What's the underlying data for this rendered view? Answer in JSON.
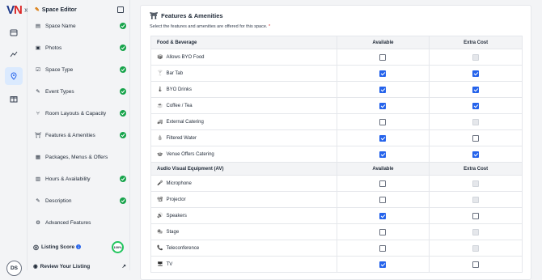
{
  "rail": {
    "logo_v": "V",
    "logo_n": "N",
    "expand": "»",
    "avatar": "DS"
  },
  "panel": {
    "title": "Space Editor",
    "items": [
      {
        "label": "Space Name",
        "done": true
      },
      {
        "label": "Photos",
        "done": true
      },
      {
        "label": "Space Type",
        "done": true
      },
      {
        "label": "Event Types",
        "done": true
      },
      {
        "label": "Room Layouts & Capacity",
        "done": true
      },
      {
        "label": "Features & Amenities",
        "done": true
      },
      {
        "label": "Packages, Menus & Offers",
        "done": false
      },
      {
        "label": "Hours & Availability",
        "done": true
      },
      {
        "label": "Description",
        "done": true
      },
      {
        "label": "Advanced Features",
        "done": false
      }
    ],
    "score_label": "Listing Score",
    "score_info": "i",
    "score_value": "100%",
    "review_label": "Review Your Listing"
  },
  "main": {
    "title": "Features & Amenities",
    "subtitle": "Select the features and amenities are offered for this space.",
    "required": "*",
    "sections": [
      {
        "heading": "Food & Beverage",
        "col1": "Available",
        "col2": "Extra Cost",
        "rows": [
          {
            "label": "Allows BYO Food",
            "available": false,
            "extra": "disabled"
          },
          {
            "label": "Bar Tab",
            "available": true,
            "extra": "on"
          },
          {
            "label": "BYO Drinks",
            "available": true,
            "extra": "on"
          },
          {
            "label": "Coffee / Tea",
            "available": true,
            "extra": "on"
          },
          {
            "label": "External Catering",
            "available": false,
            "extra": "disabled"
          },
          {
            "label": "Filtered Water",
            "available": true,
            "extra": "off"
          },
          {
            "label": "Venue Offers Catering",
            "available": true,
            "extra": "on"
          }
        ]
      },
      {
        "heading": "Audio Visual Equipment (AV)",
        "col1": "Available",
        "col2": "Extra Cost",
        "rows": [
          {
            "label": "Microphone",
            "available": false,
            "extra": "disabled"
          },
          {
            "label": "Projector",
            "available": false,
            "extra": "disabled"
          },
          {
            "label": "Speakers",
            "available": true,
            "extra": "off"
          },
          {
            "label": "Stage",
            "available": false,
            "extra": "disabled"
          },
          {
            "label": "Teleconference",
            "available": false,
            "extra": "disabled"
          },
          {
            "label": "TV",
            "available": true,
            "extra": "off"
          }
        ]
      }
    ]
  }
}
